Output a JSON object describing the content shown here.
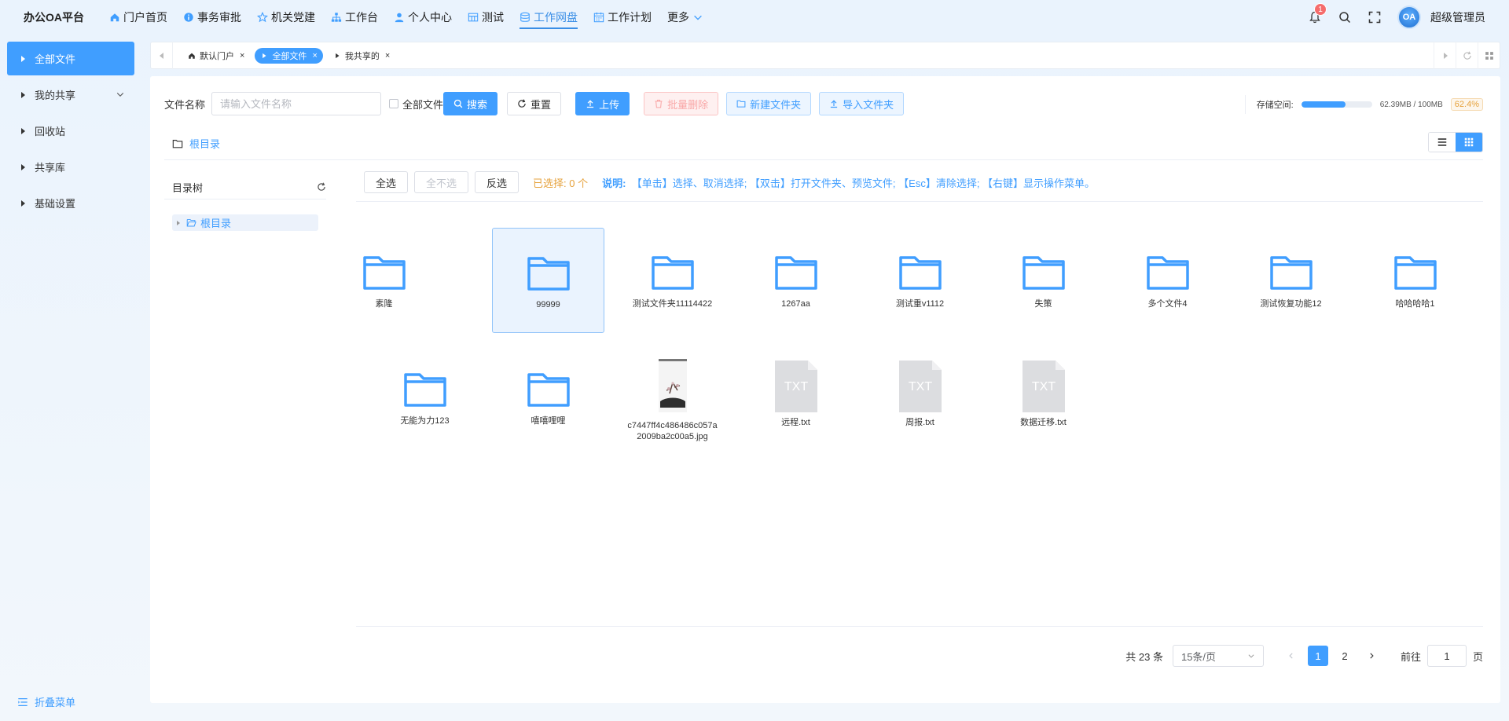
{
  "app": {
    "brand": "办公OA平台"
  },
  "nav": [
    {
      "label": "门户首页",
      "icon": "home-icon"
    },
    {
      "label": "事务审批",
      "icon": "info-icon"
    },
    {
      "label": "机关党建",
      "icon": "star-icon"
    },
    {
      "label": "工作台",
      "icon": "sitemap-icon"
    },
    {
      "label": "个人中心",
      "icon": "user-icon"
    },
    {
      "label": "测试",
      "icon": "grid-icon"
    },
    {
      "label": "工作网盘",
      "icon": "database-icon",
      "active": true
    },
    {
      "label": "工作计划",
      "icon": "calendar-icon"
    },
    {
      "label": "更多",
      "icon": "chevron-down-icon"
    }
  ],
  "header": {
    "notification_count": "1",
    "avatar_text": "OA",
    "username": "超级管理员"
  },
  "sidebar": {
    "items": [
      {
        "label": "全部文件",
        "active": true
      },
      {
        "label": "我的共享",
        "expandable": true
      },
      {
        "label": "回收站"
      },
      {
        "label": "共享库"
      },
      {
        "label": "基础设置"
      }
    ],
    "collapse_label": "折叠菜单"
  },
  "tabs": [
    {
      "label": "默认门户",
      "icon": "home-icon"
    },
    {
      "label": "全部文件",
      "icon": "caret-right-icon",
      "active": true
    },
    {
      "label": "我共享的",
      "icon": "caret-right-icon"
    }
  ],
  "toolbar": {
    "name_label": "文件名称",
    "name_placeholder": "请输入文件名称",
    "all_files_check": "全部文件",
    "search": "搜索",
    "reset": "重置",
    "upload": "上传",
    "batch_delete": "批量删除",
    "new_folder": "新建文件夹",
    "import_folder": "导入文件夹"
  },
  "storage": {
    "label": "存储空间:",
    "used_text": "62.39MB / 100MB",
    "percent_text": "62.4%",
    "fraction": 0.624
  },
  "breadcrumb": {
    "root": "根目录"
  },
  "tree": {
    "title": "目录树",
    "root": "根目录"
  },
  "selection": {
    "select_all": "全选",
    "select_none": "全不选",
    "invert": "反选",
    "selected_text": "已选择: 0 个",
    "hint_label": "说明:",
    "hint_text": "【单击】选择、取消选择; 【双击】打开文件夹、预览文件; 【Esc】清除选择; 【右键】显示操作菜单。"
  },
  "files": [
    {
      "name": "素隆",
      "type": "folder"
    },
    {
      "name": "99999",
      "type": "folder",
      "selected": true
    },
    {
      "name": "测试文件夹11114422",
      "type": "folder"
    },
    {
      "name": "1267aa",
      "type": "folder"
    },
    {
      "name": "测试重v1112",
      "type": "folder"
    },
    {
      "name": "失策",
      "type": "folder"
    },
    {
      "name": "多个文件4",
      "type": "folder"
    },
    {
      "name": "测试恢复功能12",
      "type": "folder"
    },
    {
      "name": "哈哈哈哈1",
      "type": "folder"
    },
    {
      "name": "无能为力123",
      "type": "folder"
    },
    {
      "name": "嘻嘻哩哩",
      "type": "folder"
    },
    {
      "name": "c7447ff4c486486c057a2009ba2c00a5.jpg",
      "type": "image"
    },
    {
      "name": "远程.txt",
      "type": "txt",
      "badge": "TXT"
    },
    {
      "name": "周报.txt",
      "type": "txt",
      "badge": "TXT"
    },
    {
      "name": "数据迁移.txt",
      "type": "txt",
      "badge": "TXT"
    }
  ],
  "pagination": {
    "total_text": "共 23 条",
    "page_size": "15条/页",
    "pages": [
      "1",
      "2"
    ],
    "current": "1",
    "goto_label": "前往",
    "goto_value": "1",
    "page_unit": "页"
  },
  "colors": {
    "accent": "#409eff",
    "warning": "#e6a23c",
    "danger": "#f56c6c"
  }
}
